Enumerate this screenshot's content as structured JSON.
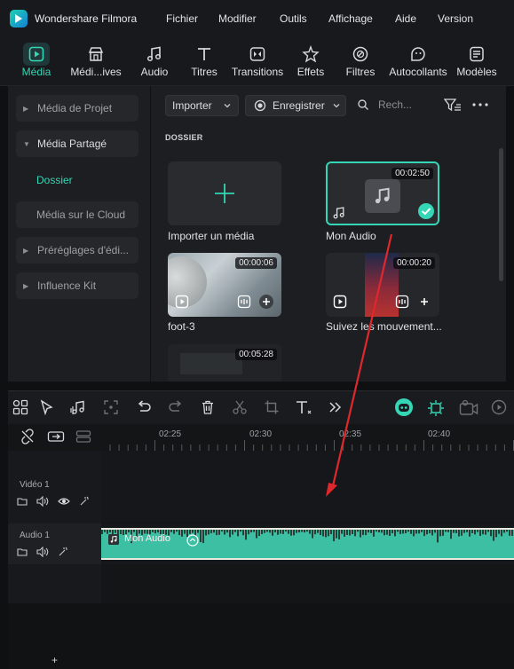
{
  "app": {
    "name": "Wondershare Filmora"
  },
  "menu": [
    "Fichier",
    "Modifier",
    "Outils",
    "Affichage",
    "Aide",
    "Version"
  ],
  "toolbar": {
    "items": [
      {
        "label": "Média",
        "icon": "media-icon",
        "active": true
      },
      {
        "label": "Médi...ives",
        "icon": "stock-media-icon",
        "active": false
      },
      {
        "label": "Audio",
        "icon": "music-note-icon",
        "active": false
      },
      {
        "label": "Titres",
        "icon": "title-t-icon",
        "active": false
      },
      {
        "label": "Transitions",
        "icon": "transitions-icon",
        "active": false
      },
      {
        "label": "Effets",
        "icon": "effects-icon",
        "active": false
      },
      {
        "label": "Filtres",
        "icon": "filters-icon",
        "active": false
      },
      {
        "label": "Autocollants",
        "icon": "stickers-icon",
        "active": false
      },
      {
        "label": "Modèles",
        "icon": "templates-icon",
        "active": false
      }
    ],
    "accent": "#34d6b5"
  },
  "sidebar": {
    "items": [
      {
        "label": "Média de Projet"
      },
      {
        "label": "Média Partagé"
      },
      {
        "label": "Dossier"
      },
      {
        "label": "Média sur le Cloud"
      },
      {
        "label": "Préréglages d'édi..."
      },
      {
        "label": "Influence Kit"
      }
    ]
  },
  "media": {
    "import_label": "Importer",
    "record_label": "Enregistrer",
    "search_placeholder": "Rech...",
    "section_label": "DOSSIER",
    "cards": [
      {
        "title": "Importer un média",
        "duration": ""
      },
      {
        "title": "Mon Audio",
        "duration": "00:02:50"
      },
      {
        "title": "foot-3",
        "duration": "00:00:06"
      },
      {
        "title": "Suivez les mouvement...",
        "duration": "00:00:20"
      },
      {
        "title": "",
        "duration": "00:05:28"
      }
    ]
  },
  "ruler": {
    "labels": [
      "02:25",
      "02:30",
      "02:35",
      "02:40"
    ]
  },
  "tracks": [
    {
      "name": "Vidéo 1"
    },
    {
      "name": "Audio 1"
    }
  ],
  "clip": {
    "label": "Mon Audio",
    "color": "#3dbfa3"
  },
  "bottom": {
    "add_label": "+"
  }
}
